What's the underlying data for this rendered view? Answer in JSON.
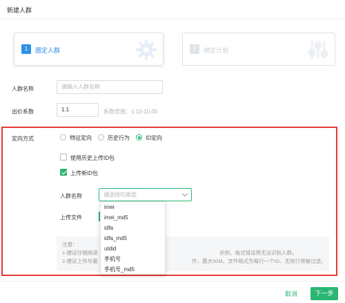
{
  "dialog": {
    "title": "新建人群"
  },
  "steps": [
    {
      "num": "1",
      "label": "圈定人群",
      "active": true,
      "icon": "gear-icon"
    },
    {
      "num": "2",
      "label": "绑定计划",
      "active": false,
      "icon": "sliders-icon"
    }
  ],
  "form": {
    "name_label": "人群名称",
    "name_placeholder": "请输入人群名称",
    "bid_label": "出价系数",
    "bid_value": "1.1",
    "bid_hint": "系数范围：1.10-10.00",
    "targeting_label": "定向方式",
    "targeting_options": [
      {
        "label": "特征定向",
        "checked": false
      },
      {
        "label": "历史行为",
        "checked": false
      },
      {
        "label": "ID定向",
        "checked": true
      }
    ],
    "use_history_label": "使用历史上传ID包",
    "use_history_checked": false,
    "upload_new_label": "上传新ID包",
    "upload_new_checked": true,
    "sub_name_label": "人群名称",
    "id_type_placeholder": "请选择ID类型",
    "upload_file_label": "上传文件"
  },
  "notes": {
    "title": "注意：",
    "line1_a": "1-建议仔细阅读",
    "line1_b": "示例，格式错误将无法识别人群。",
    "line2_a": "2-建议上传尽量",
    "line2_b": "件，最大50M，文件格式为每行一个ID、无效行将被过滤。"
  },
  "dropdown_options": [
    "imei",
    "imei_md5",
    "idfa",
    "idfa_md5",
    "utdid",
    "手机号",
    "手机号_md5"
  ],
  "footer": {
    "cancel_label": "取消",
    "next_label": "下一步"
  },
  "colors": {
    "accent_blue": "#2f8fe8",
    "accent_green": "#2bb673",
    "highlight_red": "#e53935"
  }
}
